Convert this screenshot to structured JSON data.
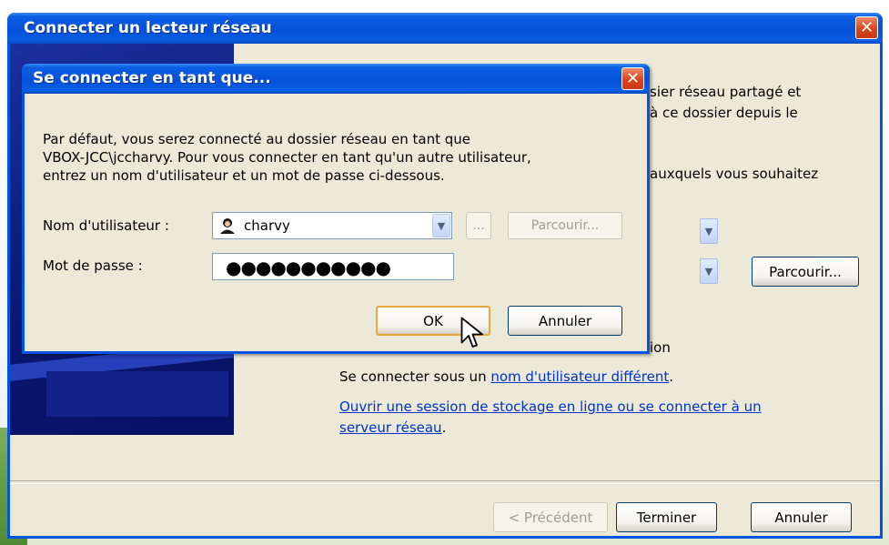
{
  "outer_window": {
    "title": "Connecter un lecteur réseau",
    "close_label": "✕",
    "behind_text": {
      "line1": "sier réseau partagé et",
      "line2": "à ce dossier depuis le",
      "line3": "auxquels vous souhaitez",
      "line4": "ion"
    },
    "browse_label": "Parcourir...",
    "different_user_prefix": "Se connecter sous un ",
    "different_user_link": "nom d'utilisateur différent",
    "different_user_suffix": ".",
    "online_storage_link_line1": "Ouvrir une session de stockage en ligne ou se connecter à un",
    "online_storage_link_line2": "serveur réseau",
    "online_storage_suffix": ".",
    "buttons": {
      "previous": "< Précédent",
      "finish": "Terminer",
      "cancel": "Annuler"
    }
  },
  "connect_as_dialog": {
    "title": "Se connecter en tant que...",
    "close_label": "✕",
    "description": [
      "Par défaut, vous serez connecté au dossier réseau en tant que",
      "VBOX-JCC\\jccharvy. Pour vous connecter en tant qu'un autre utilisateur,",
      "entrez un nom d'utilisateur et un mot de passe ci-dessous."
    ],
    "username_label": "Nom d'utilisateur :",
    "username_value": "charvy",
    "ellipsis_button": "...",
    "browse_button": "Parcourir...",
    "password_label": "Mot de passe :",
    "password_value": "●●●●●●●●●●●",
    "ok_button": "OK",
    "cancel_button": "Annuler"
  },
  "icons": {
    "user_icon": "user-icon",
    "close_icon": "close-icon",
    "dropdown_icon": "chevron-down-icon",
    "cursor": "mouse-pointer-icon"
  },
  "colors": {
    "titlebar_blue": "#0054e3",
    "dialog_face": "#ece9d8",
    "link": "#0033cc",
    "close_red": "#d9441c",
    "ok_focus": "#e8a83a"
  }
}
